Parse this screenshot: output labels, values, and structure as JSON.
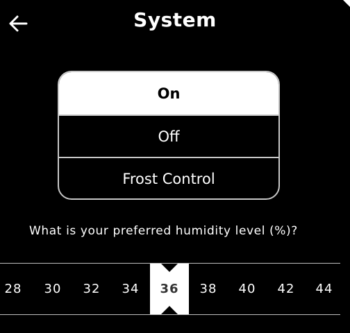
{
  "header": {
    "title": "System",
    "back_icon": "arrow-left-icon"
  },
  "system_options": [
    {
      "label": "On",
      "selected": true
    },
    {
      "label": "Off",
      "selected": false
    },
    {
      "label": "Frost Control",
      "selected": false
    }
  ],
  "humidity": {
    "question": "What is your preferred humidity level (%)?",
    "values": [
      "28",
      "30",
      "32",
      "34",
      "36",
      "38",
      "40",
      "42",
      "44"
    ],
    "selected_value": "36"
  },
  "colors": {
    "background": "#000000",
    "selected_background": "#ffffff",
    "border": "#c8c8c8"
  }
}
